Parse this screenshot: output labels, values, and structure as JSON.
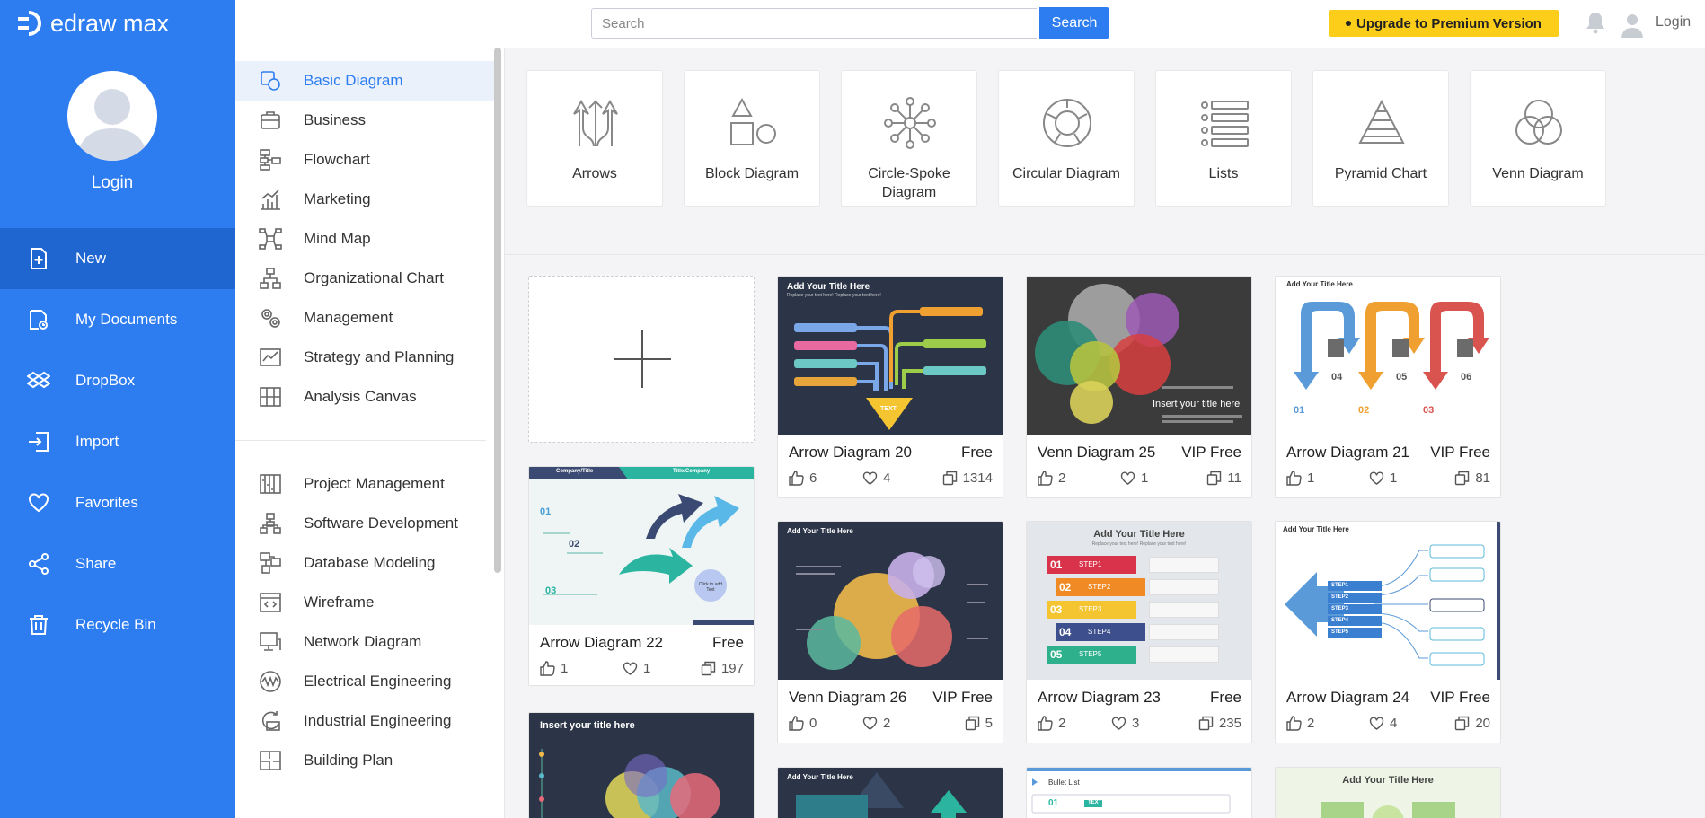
{
  "brand": {
    "name": "edraw max"
  },
  "sidebar": {
    "login": "Login",
    "items": [
      {
        "label": "New",
        "icon": "new-file-icon"
      },
      {
        "label": "My Documents",
        "icon": "documents-icon"
      },
      {
        "label": "DropBox",
        "icon": "dropbox-icon"
      },
      {
        "label": "Import",
        "icon": "import-icon"
      },
      {
        "label": "Favorites",
        "icon": "heart-icon"
      },
      {
        "label": "Share",
        "icon": "share-icon"
      },
      {
        "label": "Recycle Bin",
        "icon": "trash-icon"
      }
    ]
  },
  "topbar": {
    "search_placeholder": "Search",
    "search_button": "Search",
    "upgrade": "Upgrade to Premium Version",
    "login": "Login"
  },
  "categories": {
    "group1": [
      "Basic Diagram",
      "Business",
      "Flowchart",
      "Marketing",
      "Mind Map",
      "Organizational Chart",
      "Management",
      "Strategy and Planning",
      "Analysis Canvas"
    ],
    "group2": [
      "Project Management",
      "Software Development",
      "Database Modeling",
      "Wireframe",
      "Network Diagram",
      "Electrical Engineering",
      "Industrial Engineering",
      "Building Plan"
    ]
  },
  "subtypes": [
    {
      "label": "Arrows"
    },
    {
      "label": "Block Diagram"
    },
    {
      "label": "Circle-Spoke Diagram"
    },
    {
      "label": "Circular Diagram"
    },
    {
      "label": "Lists"
    },
    {
      "label": "Pyramid Chart"
    },
    {
      "label": "Venn Diagram"
    }
  ],
  "templates": [
    {
      "name": "Arrow Diagram 20",
      "badge": "Free",
      "likes": "6",
      "favorites": "4",
      "copies": "1314",
      "thumb_title": "Add Your Title Here",
      "thumb_sub": "Replace your text here!  Replace your text here!",
      "thumb_center": "TEXT"
    },
    {
      "name": "Venn Diagram 25",
      "badge": "VIP Free",
      "likes": "2",
      "favorites": "1",
      "copies": "11",
      "thumb_caption": "Insert your title here"
    },
    {
      "name": "Arrow Diagram 21",
      "badge": "VIP Free",
      "likes": "1",
      "favorites": "1",
      "copies": "81",
      "thumb_title": "Add Your Title Here",
      "nums": [
        "01",
        "02",
        "03",
        "04",
        "05",
        "06"
      ]
    },
    {
      "name": "Arrow Diagram 22",
      "badge": "Free",
      "likes": "1",
      "favorites": "1",
      "copies": "197",
      "thumb_tab1": "Company/Title",
      "thumb_tab2": "Title/Company",
      "nums": [
        "01",
        "02",
        "03"
      ],
      "thumb_circle": "Click to add Text"
    },
    {
      "name": "Venn Diagram 26",
      "badge": "VIP Free",
      "likes": "0",
      "favorites": "2",
      "copies": "5",
      "thumb_title": "Add Your Title Here"
    },
    {
      "name": "Arrow Diagram 23",
      "badge": "Free",
      "likes": "2",
      "favorites": "3",
      "copies": "235",
      "thumb_title": "Add Your Title Here",
      "thumb_sub": "Replace your text here!  Replace your text here!",
      "steps": [
        {
          "num": "01",
          "label": "STEP1",
          "color": "#d8334a"
        },
        {
          "num": "02",
          "label": "STEP2",
          "color": "#f08a24"
        },
        {
          "num": "03",
          "label": "STEP3",
          "color": "#f5c531"
        },
        {
          "num": "04",
          "label": "STEP4",
          "color": "#3d4f8c"
        },
        {
          "num": "05",
          "label": "STEP5",
          "color": "#2fb08c"
        }
      ]
    },
    {
      "name": "Arrow Diagram 24",
      "badge": "VIP Free",
      "likes": "2",
      "favorites": "4",
      "copies": "20",
      "thumb_title": "Add Your Title Here",
      "steps": [
        "STEP1",
        "STEP2",
        "STEP3",
        "STEP4",
        "STEP5"
      ]
    },
    {
      "thumb_title": "Insert your title here"
    },
    {
      "thumb_title": "Add Your Title Here"
    },
    {
      "thumb_title": "Bullet List",
      "nums": [
        "01"
      ],
      "thumb_tag": "TEXT"
    },
    {
      "thumb_title": "Add Your Title Here"
    }
  ],
  "colors": {
    "sidebar": "#2e7df0",
    "sidebar_active": "#1f66d1",
    "accent": "#2e7df0",
    "upgrade": "#fcce1a"
  }
}
